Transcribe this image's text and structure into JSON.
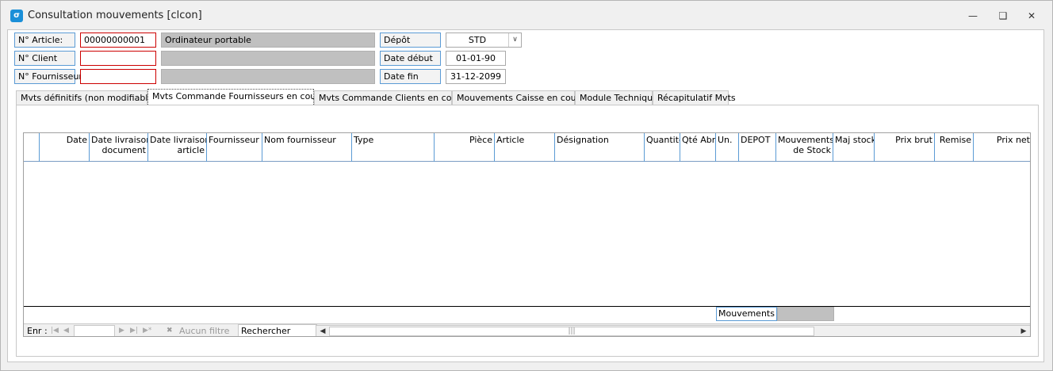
{
  "window": {
    "title": "Consultation mouvements [clcon]",
    "icon": "app-logo-icon",
    "controls": [
      "minimize-icon",
      "restore-icon",
      "close-icon"
    ]
  },
  "form": {
    "article_label": "N° Article:",
    "article_value": "00000000001",
    "article_desc": "Ordinateur portable",
    "client_label": "N° Client",
    "client_value": "",
    "client_desc": "",
    "fournisseur_label": "N° Fournisseur",
    "fournisseur_value": "",
    "fournisseur_desc": "",
    "depot_label": "Dépôt",
    "depot_value": "STD",
    "date_debut_label": "Date début",
    "date_debut_value": "01-01-90",
    "date_fin_label": "Date fin",
    "date_fin_value": "31-12-2099"
  },
  "tabs": [
    {
      "label": "Mvts définitifs (non modifiables)",
      "active": false
    },
    {
      "label": "Mvts Commande Fournisseurs en cours",
      "active": true
    },
    {
      "label": "Mvts Commande Clients en cours",
      "active": false
    },
    {
      "label": "Mouvements Caisse en cours",
      "active": false
    },
    {
      "label": "Module Technique",
      "active": false
    },
    {
      "label": "Récapitulatif Mvts",
      "active": false
    }
  ],
  "grid": {
    "columns": [
      {
        "line1": "Date",
        "line2": ""
      },
      {
        "line1": "Date livraison",
        "line2": "document"
      },
      {
        "line1": "Date livraison",
        "line2": "article"
      },
      {
        "line1": "Fournisseur",
        "line2": ""
      },
      {
        "line1": "Nom fournisseur",
        "line2": ""
      },
      {
        "line1": "Type",
        "line2": ""
      },
      {
        "line1": "Pièce",
        "line2": ""
      },
      {
        "line1": "Article",
        "line2": ""
      },
      {
        "line1": "Désignation",
        "line2": ""
      },
      {
        "line1": "Quantité",
        "line2": ""
      },
      {
        "line1": "Qté Abr",
        "line2": ""
      },
      {
        "line1": "Un.",
        "line2": ""
      },
      {
        "line1": "DEPOT",
        "line2": ""
      },
      {
        "line1": "Mouvements",
        "line2": "de Stock"
      },
      {
        "line1": "Maj stock",
        "line2": ""
      },
      {
        "line1": "Prix brut",
        "line2": ""
      },
      {
        "line1": "Remise",
        "line2": ""
      },
      {
        "line1": "Prix net",
        "line2": ""
      }
    ],
    "rows": [],
    "totals_label": "Mouvements",
    "totals_value": ""
  },
  "navigator": {
    "record_label": "Enr :",
    "record_value": "",
    "filter_label": "Aucun filtre",
    "search_label": "Rechercher"
  }
}
